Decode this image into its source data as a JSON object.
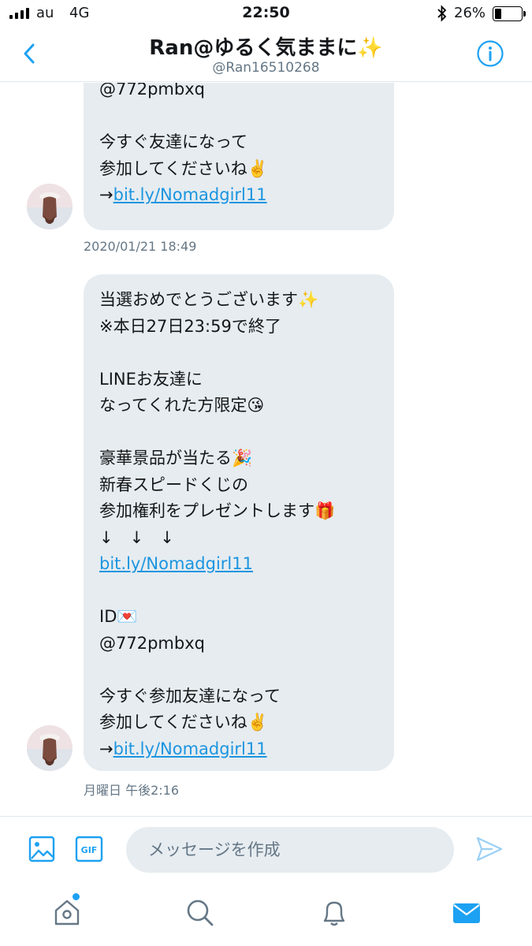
{
  "status_bar": {
    "carrier": "au",
    "network": "4G",
    "time": "22:50",
    "bluetooth_icon": "bluetooth-icon",
    "battery_percent": "26%",
    "battery_level": 0.26
  },
  "header": {
    "title": "Ran@ゆるく気ままに✨",
    "handle": "@Ran16510268",
    "back_icon": "back-chevron-icon",
    "info_icon": "info-icon"
  },
  "messages": [
    {
      "lines": [
        "@772pmbxq",
        "",
        "今すぐ友達になって",
        "参加してくださいね✌️"
      ],
      "link_prefix": "→",
      "link": "bit.ly/Nomadgirl11",
      "timestamp": "2020/01/21 18:49"
    },
    {
      "lines_a": [
        "当選おめでとうございます✨",
        "※本日27日23:59で終了",
        "",
        "LINEお友達に",
        "なってくれた方限定😘",
        "",
        "豪華景品が当たる🎉",
        "新春スピードくじの",
        "参加権利をプレゼントします🎁",
        "↓　↓　↓"
      ],
      "link_mid": "bit.ly/Nomadgirl11",
      "lines_b": [
        "",
        "ID💌",
        "@772pmbxq",
        "",
        "今すぐ参加友達になって",
        "参加してくださいね✌️"
      ],
      "link_prefix": "→",
      "link": "bit.ly/Nomadgirl11",
      "timestamp": "月曜日 午後2:16"
    }
  ],
  "composer": {
    "placeholder": "メッセージを作成",
    "gif_label": "GIF"
  },
  "colors": {
    "accent": "#1da1f2",
    "bubble": "#e6ecf0",
    "link": "#1b95e0",
    "muted": "#657786"
  }
}
